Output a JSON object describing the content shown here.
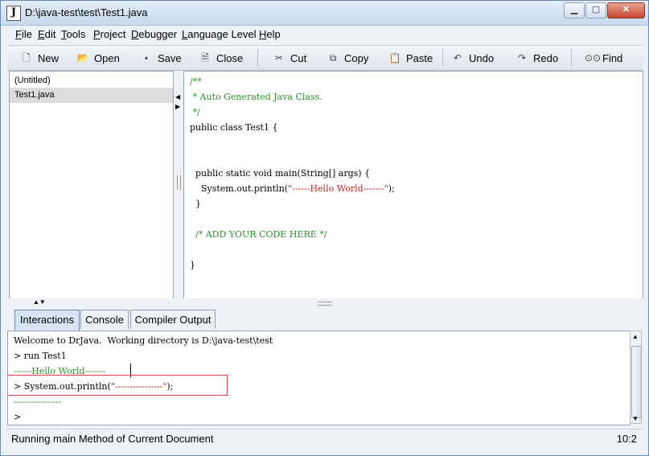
{
  "window": {
    "title": "D:\\java-test\\test\\Test1.java",
    "icon_glyph": "J"
  },
  "menu": [
    {
      "label": "File",
      "key": "F",
      "rest": "ile"
    },
    {
      "label": "Edit",
      "key": "E",
      "rest": "dit"
    },
    {
      "label": "Tools",
      "key": "T",
      "rest": "ools"
    },
    {
      "label": "Project",
      "key": "P",
      "rest": "roject"
    },
    {
      "label": "Debugger",
      "key": "D",
      "rest": "ebugger"
    },
    {
      "label": "Language Level",
      "key": "L",
      "rest": "anguage Level"
    },
    {
      "label": "Help",
      "key": "H",
      "rest": "elp"
    }
  ],
  "toolbar": {
    "new": "New",
    "open": "Open",
    "save": "Save",
    "close": "Close",
    "cut": "Cut",
    "copy": "Copy",
    "paste": "Paste",
    "undo": "Undo",
    "redo": "Redo",
    "find": "Find"
  },
  "files": [
    "(Untitled)",
    "Test1.java"
  ],
  "code": {
    "l1": "/**",
    "l2": " * Auto Generated Java Class.",
    "l3": " */",
    "l4": "public class Test1 {",
    "l7_pre": "  public static void main(String[] args) {",
    "l8_pre": "    System.out.println(",
    "l8_str": "\"------Hello World-------\"",
    "l8_post": ");",
    "l9": "  }",
    "l11": "  /* ADD YOUR CODE HERE */",
    "l13": "}"
  },
  "tabs": [
    "Interactions",
    "Console",
    "Compiler Output"
  ],
  "console": {
    "welcome": "Welcome to DrJava.  Working directory is D:\\java-test\\test",
    "run": "> run Test1",
    "output1": "------Hello World-------",
    "stmt_pre": "> System.out.println(",
    "stmt_str": "\"----------------\"",
    "stmt_post": ");",
    "output2": "----------------",
    "prompt": ">"
  },
  "status": {
    "message": "Running main Method of Current Document",
    "position": "10:2"
  },
  "colors": {
    "comment": "#2b8f2b",
    "string": "#c02020",
    "selection": "#dcdcdc"
  }
}
